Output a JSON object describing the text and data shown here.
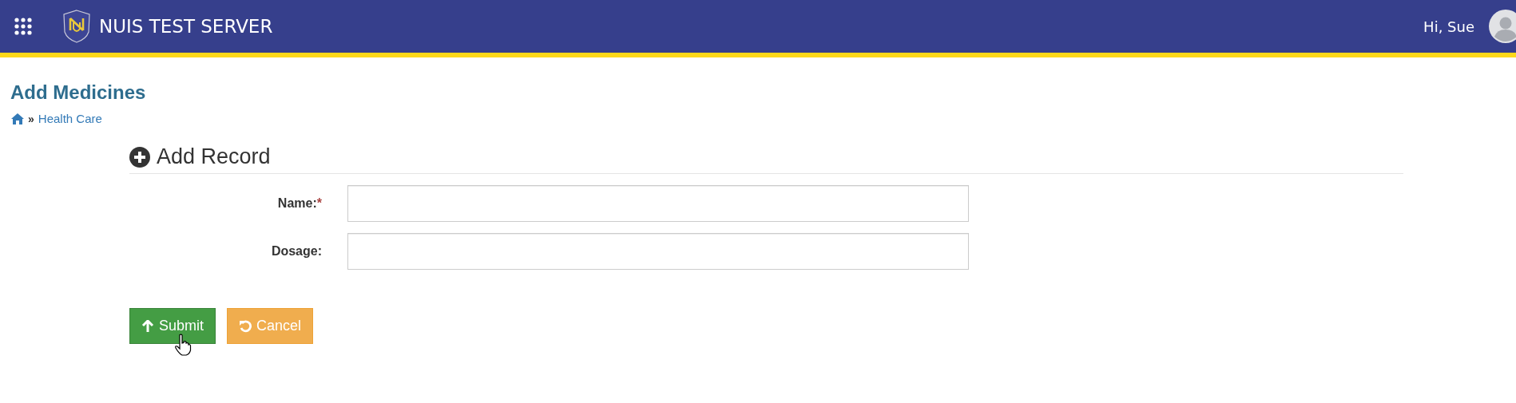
{
  "header": {
    "title": "NUIS TEST SERVER",
    "greeting": "Hi, Sue"
  },
  "page": {
    "title": "Add Medicines",
    "breadcrumb": [
      {
        "separator": "»",
        "label": "Health Care"
      }
    ]
  },
  "form": {
    "heading": "Add Record",
    "required_marker": "*",
    "fields": [
      {
        "label": "Name:",
        "required": true
      },
      {
        "label": "Dosage:",
        "required": false
      }
    ],
    "buttons": [
      {
        "label": "Submit",
        "kind": "submit"
      },
      {
        "label": "Cancel",
        "kind": "cancel"
      }
    ]
  }
}
